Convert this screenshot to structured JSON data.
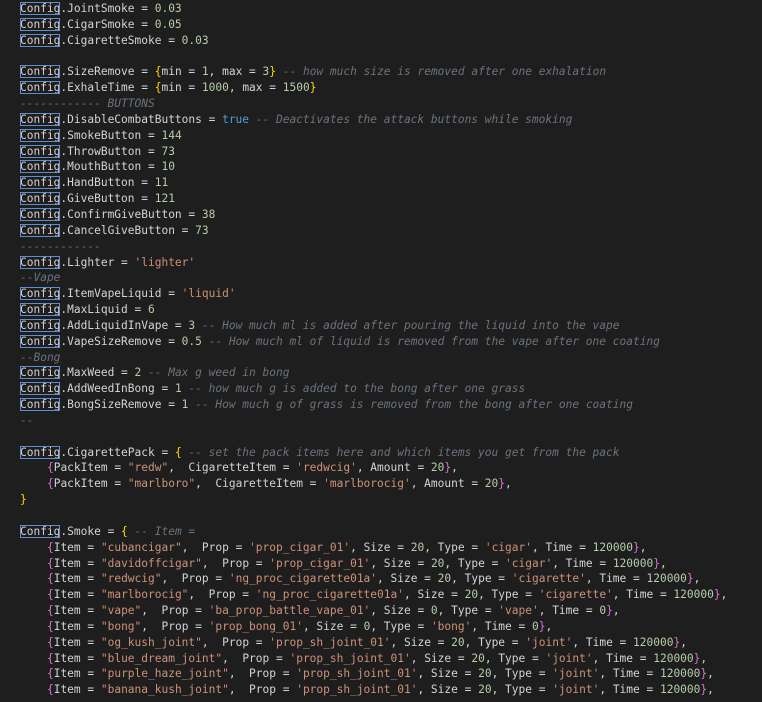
{
  "editor": {
    "language": "lua",
    "colors": {
      "background": "#1e1e1e",
      "text": "#d4d4d4",
      "number": "#b5cea8",
      "string": "#ce9178",
      "comment": "#6a737d",
      "keyword": "#569cd6",
      "brace_outer": "#ffd700",
      "brace_inner": "#da70d6",
      "highlight_box": "#5c8fd1"
    },
    "lines": [
      [
        {
          "t": "obj",
          "v": "Config"
        },
        {
          "t": "p",
          "v": ".JointSmoke = "
        },
        {
          "t": "n",
          "v": "0.03"
        }
      ],
      [
        {
          "t": "obj",
          "v": "Config"
        },
        {
          "t": "p",
          "v": ".CigarSmoke = "
        },
        {
          "t": "n",
          "v": "0.05"
        }
      ],
      [
        {
          "t": "obj",
          "v": "Config"
        },
        {
          "t": "p",
          "v": ".CigaretteSmoke = "
        },
        {
          "t": "n",
          "v": "0.03"
        }
      ],
      [],
      [
        {
          "t": "obj",
          "v": "Config"
        },
        {
          "t": "p",
          "v": ".SizeRemove = "
        },
        {
          "t": "b1",
          "v": "{"
        },
        {
          "t": "p",
          "v": "min = "
        },
        {
          "t": "n",
          "v": "1"
        },
        {
          "t": "p",
          "v": ", max = "
        },
        {
          "t": "n",
          "v": "3"
        },
        {
          "t": "b1",
          "v": "}"
        },
        {
          "t": "c",
          "v": " -- how much size is removed after one exhalation"
        }
      ],
      [
        {
          "t": "obj",
          "v": "Config"
        },
        {
          "t": "p",
          "v": ".ExhaleTime = "
        },
        {
          "t": "b1",
          "v": "{"
        },
        {
          "t": "p",
          "v": "min = "
        },
        {
          "t": "n",
          "v": "1000"
        },
        {
          "t": "p",
          "v": ", max = "
        },
        {
          "t": "n",
          "v": "1500"
        },
        {
          "t": "b1",
          "v": "}"
        }
      ],
      [
        {
          "t": "c",
          "v": "------------ BUTTONS"
        }
      ],
      [
        {
          "t": "obj",
          "v": "Config"
        },
        {
          "t": "p",
          "v": ".DisableCombatButtons = "
        },
        {
          "t": "kw",
          "v": "true"
        },
        {
          "t": "c",
          "v": " -- Deactivates the attack buttons while smoking"
        }
      ],
      [
        {
          "t": "obj",
          "v": "Config"
        },
        {
          "t": "p",
          "v": ".SmokeButton = "
        },
        {
          "t": "n",
          "v": "144"
        }
      ],
      [
        {
          "t": "obj",
          "v": "Config"
        },
        {
          "t": "p",
          "v": ".ThrowButton = "
        },
        {
          "t": "n",
          "v": "73"
        }
      ],
      [
        {
          "t": "obj",
          "v": "Config"
        },
        {
          "t": "p",
          "v": ".MouthButton = "
        },
        {
          "t": "n",
          "v": "10"
        }
      ],
      [
        {
          "t": "obj",
          "v": "Config"
        },
        {
          "t": "p",
          "v": ".HandButton = "
        },
        {
          "t": "n",
          "v": "11"
        }
      ],
      [
        {
          "t": "obj",
          "v": "Config"
        },
        {
          "t": "p",
          "v": ".GiveButton = "
        },
        {
          "t": "n",
          "v": "121"
        }
      ],
      [
        {
          "t": "obj",
          "v": "Config"
        },
        {
          "t": "p",
          "v": ".ConfirmGiveButton = "
        },
        {
          "t": "n",
          "v": "38"
        }
      ],
      [
        {
          "t": "obj",
          "v": "Config"
        },
        {
          "t": "p",
          "v": ".CancelGiveButton = "
        },
        {
          "t": "n",
          "v": "73"
        }
      ],
      [
        {
          "t": "c",
          "v": "------------"
        }
      ],
      [
        {
          "t": "obj",
          "v": "Config"
        },
        {
          "t": "p",
          "v": ".Lighter = "
        },
        {
          "t": "s",
          "v": "'lighter'"
        }
      ],
      [
        {
          "t": "c",
          "v": "--Vape"
        }
      ],
      [
        {
          "t": "obj",
          "v": "Config"
        },
        {
          "t": "p",
          "v": ".ItemVapeLiquid = "
        },
        {
          "t": "s",
          "v": "'liquid'"
        }
      ],
      [
        {
          "t": "obj",
          "v": "Config"
        },
        {
          "t": "p",
          "v": ".MaxLiquid = "
        },
        {
          "t": "n",
          "v": "6"
        }
      ],
      [
        {
          "t": "obj",
          "v": "Config"
        },
        {
          "t": "p",
          "v": ".AddLiquidInVape = "
        },
        {
          "t": "n",
          "v": "3"
        },
        {
          "t": "c",
          "v": " -- How much ml is added after pouring the liquid into the vape"
        }
      ],
      [
        {
          "t": "obj",
          "v": "Config"
        },
        {
          "t": "p",
          "v": ".VapeSizeRemove = "
        },
        {
          "t": "n",
          "v": "0.5"
        },
        {
          "t": "c",
          "v": " -- How much ml of liquid is removed from the vape after one coating"
        }
      ],
      [
        {
          "t": "c",
          "v": "--Bong"
        }
      ],
      [
        {
          "t": "obj",
          "v": "Config"
        },
        {
          "t": "p",
          "v": ".MaxWeed = "
        },
        {
          "t": "n",
          "v": "2"
        },
        {
          "t": "c",
          "v": " -- Max g weed in bong"
        }
      ],
      [
        {
          "t": "obj",
          "v": "Config"
        },
        {
          "t": "p",
          "v": ".AddWeedInBong = "
        },
        {
          "t": "n",
          "v": "1"
        },
        {
          "t": "c",
          "v": " -- how much g is added to the bong after one grass"
        }
      ],
      [
        {
          "t": "obj",
          "v": "Config"
        },
        {
          "t": "p",
          "v": ".BongSizeRemove = "
        },
        {
          "t": "n",
          "v": "1"
        },
        {
          "t": "c",
          "v": " -- How much g of grass is removed from the bong after one coating"
        }
      ],
      [
        {
          "t": "c",
          "v": "--"
        }
      ],
      [],
      [
        {
          "t": "obj",
          "v": "Config"
        },
        {
          "t": "p",
          "v": ".CigarettePack = "
        },
        {
          "t": "b1",
          "v": "{"
        },
        {
          "t": "c",
          "v": " -- set the pack items here and which items you get from the pack"
        }
      ],
      [
        {
          "t": "p",
          "v": "    "
        },
        {
          "t": "b2",
          "v": "{"
        },
        {
          "t": "p",
          "v": "PackItem = "
        },
        {
          "t": "s",
          "v": "\"redw\""
        },
        {
          "t": "p",
          "v": ",  CigaretteItem = "
        },
        {
          "t": "s",
          "v": "'redwcig'"
        },
        {
          "t": "p",
          "v": ", Amount = "
        },
        {
          "t": "n",
          "v": "20"
        },
        {
          "t": "b2",
          "v": "}"
        },
        {
          "t": "p",
          "v": ","
        }
      ],
      [
        {
          "t": "p",
          "v": "    "
        },
        {
          "t": "b2",
          "v": "{"
        },
        {
          "t": "p",
          "v": "PackItem = "
        },
        {
          "t": "s",
          "v": "\"marlboro\""
        },
        {
          "t": "p",
          "v": ",  CigaretteItem = "
        },
        {
          "t": "s",
          "v": "'marlborocig'"
        },
        {
          "t": "p",
          "v": ", Amount = "
        },
        {
          "t": "n",
          "v": "20"
        },
        {
          "t": "b2",
          "v": "}"
        },
        {
          "t": "p",
          "v": ","
        }
      ],
      [
        {
          "t": "b1",
          "v": "}"
        }
      ],
      [],
      [
        {
          "t": "obj",
          "v": "Config"
        },
        {
          "t": "p",
          "v": ".Smoke = "
        },
        {
          "t": "b1",
          "v": "{"
        },
        {
          "t": "c",
          "v": " -- Item ="
        }
      ],
      [
        {
          "t": "p",
          "v": "    "
        },
        {
          "t": "b2",
          "v": "{"
        },
        {
          "t": "p",
          "v": "Item = "
        },
        {
          "t": "s",
          "v": "\"cubancigar\""
        },
        {
          "t": "p",
          "v": ",  Prop = "
        },
        {
          "t": "s",
          "v": "'prop_cigar_01'"
        },
        {
          "t": "p",
          "v": ", Size = "
        },
        {
          "t": "n",
          "v": "20"
        },
        {
          "t": "p",
          "v": ", Type = "
        },
        {
          "t": "s",
          "v": "'cigar'"
        },
        {
          "t": "p",
          "v": ", Time = "
        },
        {
          "t": "n",
          "v": "120000"
        },
        {
          "t": "b2",
          "v": "}"
        },
        {
          "t": "p",
          "v": ","
        }
      ],
      [
        {
          "t": "p",
          "v": "    "
        },
        {
          "t": "b2",
          "v": "{"
        },
        {
          "t": "p",
          "v": "Item = "
        },
        {
          "t": "s",
          "v": "\"davidoffcigar\""
        },
        {
          "t": "p",
          "v": ",  Prop = "
        },
        {
          "t": "s",
          "v": "'prop_cigar_01'"
        },
        {
          "t": "p",
          "v": ", Size = "
        },
        {
          "t": "n",
          "v": "20"
        },
        {
          "t": "p",
          "v": ", Type = "
        },
        {
          "t": "s",
          "v": "'cigar'"
        },
        {
          "t": "p",
          "v": ", Time = "
        },
        {
          "t": "n",
          "v": "120000"
        },
        {
          "t": "b2",
          "v": "}"
        },
        {
          "t": "p",
          "v": ","
        }
      ],
      [
        {
          "t": "p",
          "v": "    "
        },
        {
          "t": "b2",
          "v": "{"
        },
        {
          "t": "p",
          "v": "Item = "
        },
        {
          "t": "s",
          "v": "\"redwcig\""
        },
        {
          "t": "p",
          "v": ",  Prop = "
        },
        {
          "t": "s",
          "v": "'ng_proc_cigarette01a'"
        },
        {
          "t": "p",
          "v": ", Size = "
        },
        {
          "t": "n",
          "v": "20"
        },
        {
          "t": "p",
          "v": ", Type = "
        },
        {
          "t": "s",
          "v": "'cigarette'"
        },
        {
          "t": "p",
          "v": ", Time = "
        },
        {
          "t": "n",
          "v": "120000"
        },
        {
          "t": "b2",
          "v": "}"
        },
        {
          "t": "p",
          "v": ","
        }
      ],
      [
        {
          "t": "p",
          "v": "    "
        },
        {
          "t": "b2",
          "v": "{"
        },
        {
          "t": "p",
          "v": "Item = "
        },
        {
          "t": "s",
          "v": "\"marlborocig\""
        },
        {
          "t": "p",
          "v": ",  Prop = "
        },
        {
          "t": "s",
          "v": "'ng_proc_cigarette01a'"
        },
        {
          "t": "p",
          "v": ", Size = "
        },
        {
          "t": "n",
          "v": "20"
        },
        {
          "t": "p",
          "v": ", Type = "
        },
        {
          "t": "s",
          "v": "'cigarette'"
        },
        {
          "t": "p",
          "v": ", Time = "
        },
        {
          "t": "n",
          "v": "120000"
        },
        {
          "t": "b2",
          "v": "}"
        },
        {
          "t": "p",
          "v": ","
        }
      ],
      [
        {
          "t": "p",
          "v": "    "
        },
        {
          "t": "b2",
          "v": "{"
        },
        {
          "t": "p",
          "v": "Item = "
        },
        {
          "t": "s",
          "v": "\"vape\""
        },
        {
          "t": "p",
          "v": ",  Prop = "
        },
        {
          "t": "s",
          "v": "'ba_prop_battle_vape_01'"
        },
        {
          "t": "p",
          "v": ", Size = "
        },
        {
          "t": "n",
          "v": "0"
        },
        {
          "t": "p",
          "v": ", Type = "
        },
        {
          "t": "s",
          "v": "'vape'"
        },
        {
          "t": "p",
          "v": ", Time = "
        },
        {
          "t": "n",
          "v": "0"
        },
        {
          "t": "b2",
          "v": "}"
        },
        {
          "t": "p",
          "v": ","
        }
      ],
      [
        {
          "t": "p",
          "v": "    "
        },
        {
          "t": "b2",
          "v": "{"
        },
        {
          "t": "p",
          "v": "Item = "
        },
        {
          "t": "s",
          "v": "\"bong\""
        },
        {
          "t": "p",
          "v": ",  Prop = "
        },
        {
          "t": "s",
          "v": "'prop_bong_01'"
        },
        {
          "t": "p",
          "v": ", Size = "
        },
        {
          "t": "n",
          "v": "0"
        },
        {
          "t": "p",
          "v": ", Type = "
        },
        {
          "t": "s",
          "v": "'bong'"
        },
        {
          "t": "p",
          "v": ", Time = "
        },
        {
          "t": "n",
          "v": "0"
        },
        {
          "t": "b2",
          "v": "}"
        },
        {
          "t": "p",
          "v": ","
        }
      ],
      [
        {
          "t": "p",
          "v": "    "
        },
        {
          "t": "b2",
          "v": "{"
        },
        {
          "t": "p",
          "v": "Item = "
        },
        {
          "t": "s",
          "v": "\"og_kush_joint\""
        },
        {
          "t": "p",
          "v": ",  Prop = "
        },
        {
          "t": "s",
          "v": "'prop_sh_joint_01'"
        },
        {
          "t": "p",
          "v": ", Size = "
        },
        {
          "t": "n",
          "v": "20"
        },
        {
          "t": "p",
          "v": ", Type = "
        },
        {
          "t": "s",
          "v": "'joint'"
        },
        {
          "t": "p",
          "v": ", Time = "
        },
        {
          "t": "n",
          "v": "120000"
        },
        {
          "t": "b2",
          "v": "}"
        },
        {
          "t": "p",
          "v": ","
        }
      ],
      [
        {
          "t": "p",
          "v": "    "
        },
        {
          "t": "b2",
          "v": "{"
        },
        {
          "t": "p",
          "v": "Item = "
        },
        {
          "t": "s",
          "v": "\"blue_dream_joint\""
        },
        {
          "t": "p",
          "v": ",  Prop = "
        },
        {
          "t": "s",
          "v": "'prop_sh_joint_01'"
        },
        {
          "t": "p",
          "v": ", Size = "
        },
        {
          "t": "n",
          "v": "20"
        },
        {
          "t": "p",
          "v": ", Type = "
        },
        {
          "t": "s",
          "v": "'joint'"
        },
        {
          "t": "p",
          "v": ", Time = "
        },
        {
          "t": "n",
          "v": "120000"
        },
        {
          "t": "b2",
          "v": "}"
        },
        {
          "t": "p",
          "v": ","
        }
      ],
      [
        {
          "t": "p",
          "v": "    "
        },
        {
          "t": "b2",
          "v": "{"
        },
        {
          "t": "p",
          "v": "Item = "
        },
        {
          "t": "s",
          "v": "\"purple_haze_joint\""
        },
        {
          "t": "p",
          "v": ",  Prop = "
        },
        {
          "t": "s",
          "v": "'prop_sh_joint_01'"
        },
        {
          "t": "p",
          "v": ", Size = "
        },
        {
          "t": "n",
          "v": "20"
        },
        {
          "t": "p",
          "v": ", Type = "
        },
        {
          "t": "s",
          "v": "'joint'"
        },
        {
          "t": "p",
          "v": ", Time = "
        },
        {
          "t": "n",
          "v": "120000"
        },
        {
          "t": "b2",
          "v": "}"
        },
        {
          "t": "p",
          "v": ","
        }
      ],
      [
        {
          "t": "p",
          "v": "    "
        },
        {
          "t": "b2",
          "v": "{"
        },
        {
          "t": "p",
          "v": "Item = "
        },
        {
          "t": "s",
          "v": "\"banana_kush_joint\""
        },
        {
          "t": "p",
          "v": ",  Prop = "
        },
        {
          "t": "s",
          "v": "'prop_sh_joint_01'"
        },
        {
          "t": "p",
          "v": ", Size = "
        },
        {
          "t": "n",
          "v": "20"
        },
        {
          "t": "p",
          "v": ", Type = "
        },
        {
          "t": "s",
          "v": "'joint'"
        },
        {
          "t": "p",
          "v": ", Time = "
        },
        {
          "t": "n",
          "v": "120000"
        },
        {
          "t": "b2",
          "v": "}"
        },
        {
          "t": "p",
          "v": ","
        }
      ]
    ]
  }
}
